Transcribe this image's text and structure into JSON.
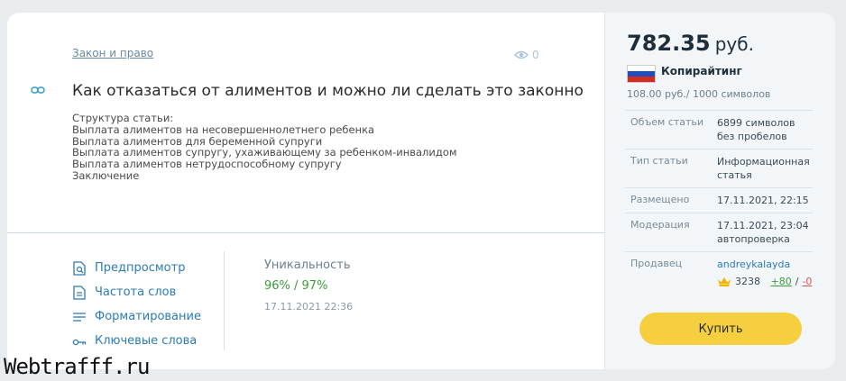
{
  "article": {
    "category": "Закон и право",
    "views": "0",
    "title": "Как отказаться от алиментов и можно ли сделать это законно",
    "structure": "Структура статьи:\nВыплата алиментов на несовершеннолетнего ребенка\nВыплата алиментов для беременной супруги\nВыплата алиментов супругу, ухаживающему за ребенком-инвалидом\nВыплата алиментов нетрудоспособному супругу\nЗаключение"
  },
  "actions": [
    {
      "label": "Предпросмотр",
      "icon": "preview-icon"
    },
    {
      "label": "Частота слов",
      "icon": "document-icon"
    },
    {
      "label": "Форматирование",
      "icon": "align-icon"
    },
    {
      "label": "Ключевые слова",
      "icon": "key-icon"
    }
  ],
  "uniqueness": {
    "label": "Уникальность",
    "value": "96% / 97%",
    "date": "17.11.2021 22:36"
  },
  "offer": {
    "price": "782.35",
    "currency": "руб.",
    "category": "Копирайтинг",
    "rate": "108.00 руб./ 1000 символов",
    "flag_colors": [
      "#ffffff",
      "#1f4fbf",
      "#d52b1e"
    ],
    "props": [
      {
        "key": "Объем статьи",
        "value": "6899 символов без пробелов"
      },
      {
        "key": "Тип статьи",
        "value": "Информационная статья"
      },
      {
        "key": "Размещено",
        "value": "17.11.2021, 22:15"
      },
      {
        "key": "Модерация",
        "value": "17.11.2021, 23:04 автопроверка"
      }
    ],
    "seller": {
      "key": "Продавец",
      "name": "andreykalayda",
      "rating": "3238",
      "plus": "+80",
      "separator": "/",
      "minus": "-0"
    },
    "buy_label": "Купить"
  },
  "watermark": "Webtrafff.ru",
  "colors": {
    "accent": "#2b7bb5",
    "button": "#f6cf3f",
    "positive": "#3c9a3c",
    "negative": "#d9534f"
  }
}
